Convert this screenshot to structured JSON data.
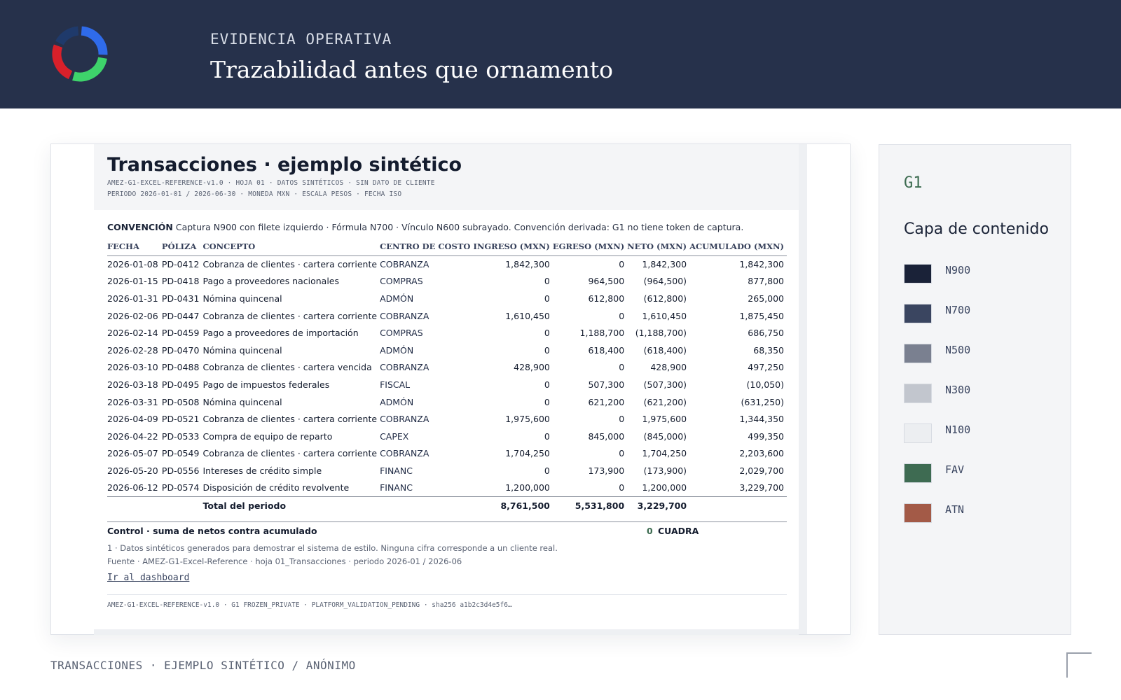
{
  "header": {
    "kicker": "EVIDENCIA OPERATIVA",
    "title": "Trazabilidad antes que ornamento"
  },
  "logo": {
    "icon": "donut-logo-icon",
    "colors": [
      "#1f3a6b",
      "#2f6bea",
      "#3ed36b",
      "#d8202a"
    ]
  },
  "document": {
    "title": "Transacciones · ejemplo sintético",
    "meta_line1": "AMEZ-G1-EXCEL-REFERENCE-v1.0 · HOJA 01 · DATOS SINTÉTICOS · SIN DATO DE CLIENTE",
    "meta_line2": "PERIODO 2026-01-01 / 2026-06-30 · MONEDA MXN · ESCALA PESOS · FECHA ISO",
    "convention_label": "CONVENCIÓN",
    "convention_text": "Captura N900 con filete izquierdo · Fórmula N700 · Vínculo N600 subrayado. Convención derivada: G1 no tiene token de captura.",
    "columns": [
      "FECHA",
      "PÓLIZA",
      "CONCEPTO",
      "CENTRO DE COSTO",
      "INGRESO (MXN)",
      "EGRESO (MXN)",
      "NETO (MXN)",
      "ACUMULADO (MXN)"
    ],
    "rows": [
      {
        "fecha": "2026-01-08",
        "poliza": "PD-0412",
        "concepto": "Cobranza de clientes · cartera corriente",
        "centro": "COBRANZA",
        "ingreso": "1,842,300",
        "egreso": "0",
        "neto": "1,842,300",
        "acumulado": "1,842,300"
      },
      {
        "fecha": "2026-01-15",
        "poliza": "PD-0418",
        "concepto": "Pago a proveedores nacionales",
        "centro": "COMPRAS",
        "ingreso": "0",
        "egreso": "964,500",
        "neto": "(964,500)",
        "acumulado": "877,800"
      },
      {
        "fecha": "2026-01-31",
        "poliza": "PD-0431",
        "concepto": "Nómina quincenal",
        "centro": "ADMÓN",
        "ingreso": "0",
        "egreso": "612,800",
        "neto": "(612,800)",
        "acumulado": "265,000"
      },
      {
        "fecha": "2026-02-06",
        "poliza": "PD-0447",
        "concepto": "Cobranza de clientes · cartera corriente",
        "centro": "COBRANZA",
        "ingreso": "1,610,450",
        "egreso": "0",
        "neto": "1,610,450",
        "acumulado": "1,875,450"
      },
      {
        "fecha": "2026-02-14",
        "poliza": "PD-0459",
        "concepto": "Pago a proveedores de importación",
        "centro": "COMPRAS",
        "ingreso": "0",
        "egreso": "1,188,700",
        "neto": "(1,188,700)",
        "acumulado": "686,750"
      },
      {
        "fecha": "2026-02-28",
        "poliza": "PD-0470",
        "concepto": "Nómina quincenal",
        "centro": "ADMÓN",
        "ingreso": "0",
        "egreso": "618,400",
        "neto": "(618,400)",
        "acumulado": "68,350"
      },
      {
        "fecha": "2026-03-10",
        "poliza": "PD-0488",
        "concepto": "Cobranza de clientes · cartera vencida",
        "centro": "COBRANZA",
        "ingreso": "428,900",
        "egreso": "0",
        "neto": "428,900",
        "acumulado": "497,250"
      },
      {
        "fecha": "2026-03-18",
        "poliza": "PD-0495",
        "concepto": "Pago de impuestos federales",
        "centro": "FISCAL",
        "ingreso": "0",
        "egreso": "507,300",
        "neto": "(507,300)",
        "acumulado": "(10,050)"
      },
      {
        "fecha": "2026-03-31",
        "poliza": "PD-0508",
        "concepto": "Nómina quincenal",
        "centro": "ADMÓN",
        "ingreso": "0",
        "egreso": "621,200",
        "neto": "(621,200)",
        "acumulado": "(631,250)"
      },
      {
        "fecha": "2026-04-09",
        "poliza": "PD-0521",
        "concepto": "Cobranza de clientes · cartera corriente",
        "centro": "COBRANZA",
        "ingreso": "1,975,600",
        "egreso": "0",
        "neto": "1,975,600",
        "acumulado": "1,344,350"
      },
      {
        "fecha": "2026-04-22",
        "poliza": "PD-0533",
        "concepto": "Compra de equipo de reparto",
        "centro": "CAPEX",
        "ingreso": "0",
        "egreso": "845,000",
        "neto": "(845,000)",
        "acumulado": "499,350"
      },
      {
        "fecha": "2026-05-07",
        "poliza": "PD-0549",
        "concepto": "Cobranza de clientes · cartera corriente",
        "centro": "COBRANZA",
        "ingreso": "1,704,250",
        "egreso": "0",
        "neto": "1,704,250",
        "acumulado": "2,203,600"
      },
      {
        "fecha": "2026-05-20",
        "poliza": "PD-0556",
        "concepto": "Intereses de crédito simple",
        "centro": "FINANC",
        "ingreso": "0",
        "egreso": "173,900",
        "neto": "(173,900)",
        "acumulado": "2,029,700"
      },
      {
        "fecha": "2026-06-12",
        "poliza": "PD-0574",
        "concepto": "Disposición de crédito revolvente",
        "centro": "FINANC",
        "ingreso": "1,200,000",
        "egreso": "0",
        "neto": "1,200,000",
        "acumulado": "3,229,700"
      }
    ],
    "total": {
      "label": "Total del periodo",
      "ingreso": "8,761,500",
      "egreso": "5,531,800",
      "neto": "3,229,700"
    },
    "control": {
      "label": "Control · suma de netos contra acumulado",
      "value": "0",
      "status": "CUADRA"
    },
    "note1": "1 · Datos sintéticos generados para demostrar el sistema de estilo. Ninguna cifra corresponde a un cliente real.",
    "note2": "Fuente · AMEZ-G1-Excel-Reference · hoja 01_Transacciones · periodo 2026-01 / 2026-06",
    "link": "Ir al dashboard",
    "footer_meta": "AMEZ-G1-EXCEL-REFERENCE-v1.0 · G1 FROZEN_PRIVATE · PLATFORM_VALIDATION_PENDING · sha256 a1b2c3d4e5f6…"
  },
  "legend": {
    "code": "G1",
    "title": "Capa de contenido",
    "swatches": [
      {
        "label": "N900",
        "color": "#1a2238"
      },
      {
        "label": "N700",
        "color": "#3a4560"
      },
      {
        "label": "N500",
        "color": "#7a8090"
      },
      {
        "label": "N300",
        "color": "#c2c6ce"
      },
      {
        "label": "N100",
        "color": "#eceef1"
      },
      {
        "label": "FAV",
        "color": "#3e6b52"
      },
      {
        "label": "ATN",
        "color": "#a35a47"
      }
    ]
  },
  "footer": {
    "caption": "TRANSACCIONES · EJEMPLO SINTÉTICO / ANÓNIMO"
  }
}
